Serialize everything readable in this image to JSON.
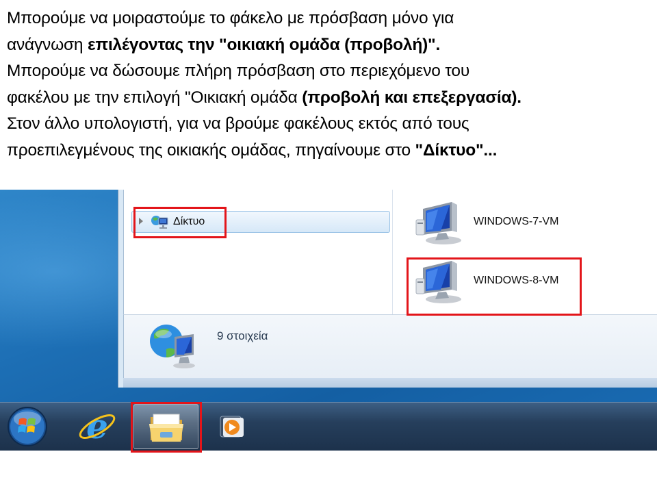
{
  "slide": {
    "line1": "Μπορούμε να μοιραστούμε το φάκελο με πρόσβαση μόνο για",
    "line2_plain": "ανάγνωση ",
    "line2_bold": "επιλέγοντας την \"οικιακή ομάδα (προβολή)\".",
    "line3": "Μπορούμε να δώσουμε πλήρη πρόσβαση στο περιεχόμενο του",
    "line4_plain": "φακέλου με την επιλογή \"Οικιακή ομάδα ",
    "line4_bold": "(προβολή και επεξεργασία).",
    "line5": "Στον άλλο υπολογιστή, για να βρούμε φακέλους εκτός από τους",
    "line6_plain": "προεπιλεγμένους της οικιακής ομάδας, πηγαίνουμε στο ",
    "line6_bold": "\"Δίκτυο\"..."
  },
  "explorer": {
    "nav_item_label": "Δίκτυο",
    "files": [
      {
        "name": "WINDOWS-7-VM",
        "icon": "computer-icon"
      },
      {
        "name": "WINDOWS-8-VM",
        "icon": "computer-icon"
      }
    ],
    "details_count": "9 στοιχεία"
  },
  "taskbar": {
    "items": [
      "start-orb-icon",
      "internet-explorer-icon",
      "windows-explorer-icon",
      "media-player-icon"
    ]
  },
  "colors": {
    "highlight": "#e3151a",
    "taskbar": "#263f5c",
    "desktop": "#1d6fb5"
  }
}
